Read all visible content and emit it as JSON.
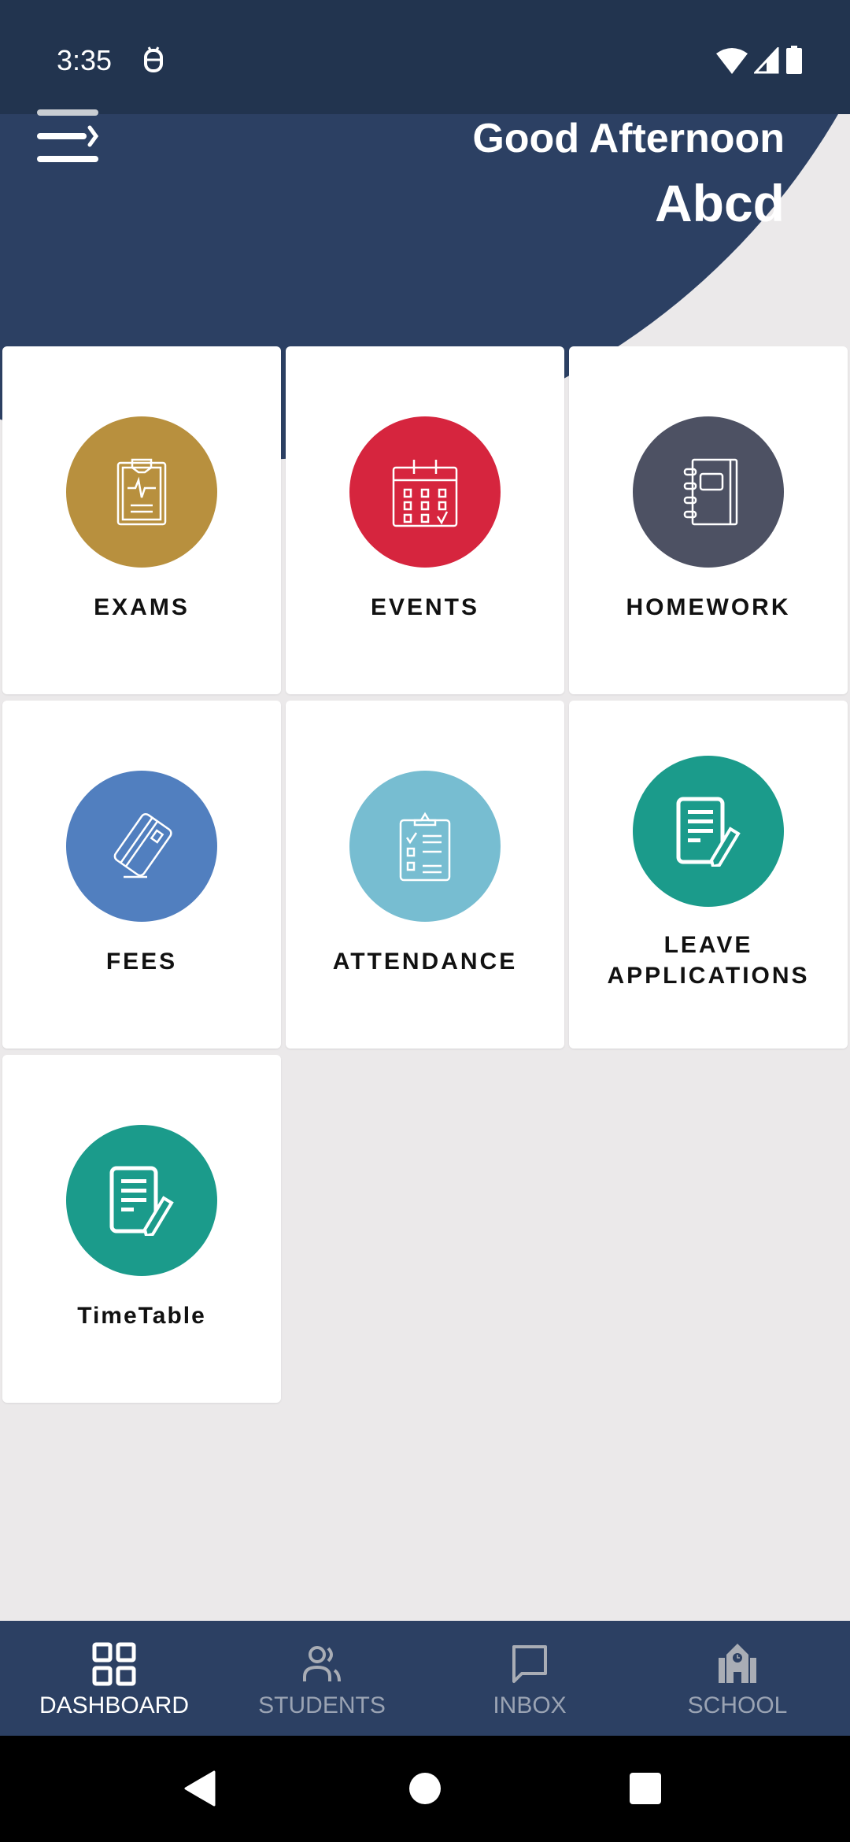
{
  "status_bar": {
    "time": "3:35",
    "icons": [
      "debug-icon",
      "wifi-icon",
      "signal-icon",
      "battery-icon"
    ]
  },
  "header": {
    "greeting": "Good Afternoon",
    "user_name": "Abcd",
    "menu_icon": "menu-arrow-icon"
  },
  "colors": {
    "header": "#2c4063",
    "status_bar": "#22344f",
    "background": "#ebe9ea"
  },
  "tiles": [
    {
      "label": "EXAMS",
      "icon": "clipboard-pulse-icon",
      "color": "#b8903e"
    },
    {
      "label": "EVENTS",
      "icon": "calendar-icon",
      "color": "#d6253e"
    },
    {
      "label": "HOMEWORK",
      "icon": "notebook-icon",
      "color": "#4d5163"
    },
    {
      "label": "FEES",
      "icon": "credit-card-icon",
      "color": "#517fbf"
    },
    {
      "label": "ATTENDANCE",
      "icon": "checklist-icon",
      "color": "#77bdd1"
    },
    {
      "label_line1": "LEAVE",
      "label_line2": "APPLICATIONS",
      "icon": "document-edit-icon",
      "color": "#1b9b8b"
    },
    {
      "label": "TimeTable",
      "icon": "document-edit-icon",
      "color": "#1b9b8b"
    }
  ],
  "bottom_nav": {
    "items": [
      {
        "label": "DASHBOARD",
        "icon": "grid-icon",
        "active": true
      },
      {
        "label": "STUDENTS",
        "icon": "people-icon",
        "active": false
      },
      {
        "label": "INBOX",
        "icon": "chat-icon",
        "active": false
      },
      {
        "label": "SCHOOL",
        "icon": "school-icon",
        "active": false
      }
    ]
  }
}
